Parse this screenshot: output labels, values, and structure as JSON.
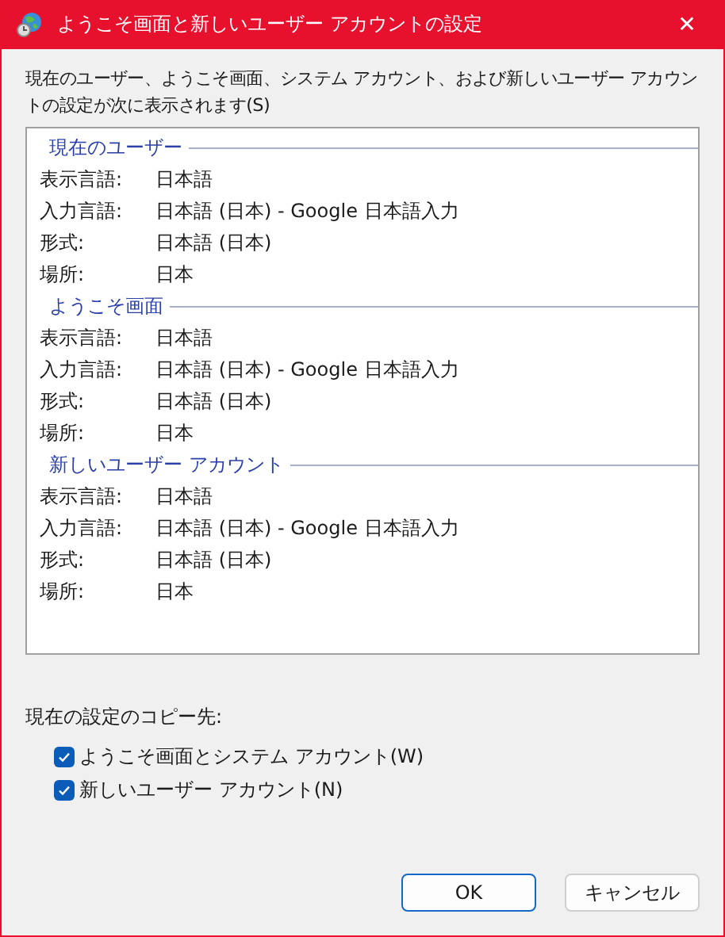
{
  "window": {
    "title": "ようこそ画面と新しいユーザー アカウントの設定",
    "close": "✕"
  },
  "description": "現在のユーザー、ようこそ画面、システム アカウント、および新しいユーザー アカウントの設定が次に表示されます(S)",
  "groups": [
    {
      "title": "現在のユーザー",
      "rows": [
        {
          "label": "表示言語:",
          "value": "日本語"
        },
        {
          "label": "入力言語:",
          "value": "日本語 (日本) - Google 日本語入力"
        },
        {
          "label": "形式:",
          "value": "日本語 (日本)"
        },
        {
          "label": "場所:",
          "value": "日本"
        }
      ]
    },
    {
      "title": "ようこそ画面",
      "rows": [
        {
          "label": "表示言語:",
          "value": "日本語"
        },
        {
          "label": "入力言語:",
          "value": "日本語 (日本) - Google 日本語入力"
        },
        {
          "label": "形式:",
          "value": "日本語 (日本)"
        },
        {
          "label": "場所:",
          "value": "日本"
        }
      ]
    },
    {
      "title": "新しいユーザー アカウント",
      "rows": [
        {
          "label": "表示言語:",
          "value": "日本語"
        },
        {
          "label": "入力言語:",
          "value": "日本語 (日本) - Google 日本語入力"
        },
        {
          "label": "形式:",
          "value": "日本語 (日本)"
        },
        {
          "label": "場所:",
          "value": "日本"
        }
      ]
    }
  ],
  "copy_to": {
    "label": "現在の設定のコピー先:",
    "options": [
      {
        "label": "ようこそ画面とシステム アカウント(W)",
        "checked": true
      },
      {
        "label": "新しいユーザー アカウント(N)",
        "checked": true
      }
    ]
  },
  "buttons": [
    {
      "label": "OK",
      "default": true
    },
    {
      "label": "キャンセル",
      "default": false
    }
  ]
}
